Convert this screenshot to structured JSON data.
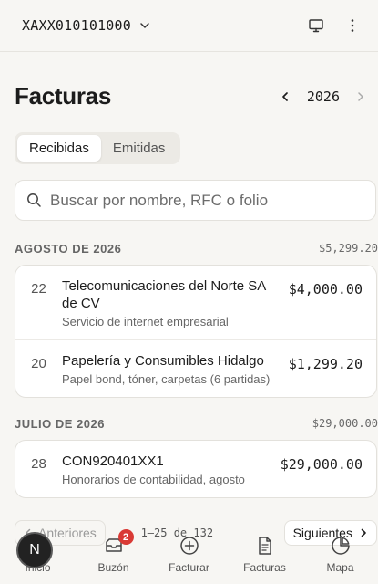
{
  "topbar": {
    "rfc": "XAXX010101000"
  },
  "header": {
    "title": "Facturas",
    "year": "2026"
  },
  "tabs": [
    {
      "label": "Recibidas",
      "active": true
    },
    {
      "label": "Emitidas",
      "active": false
    }
  ],
  "search": {
    "placeholder": "Buscar por nombre, RFC o folio"
  },
  "sections": [
    {
      "month": "AGOSTO DE 2026",
      "total": "$5,299.20",
      "items": [
        {
          "day": "22",
          "name": "Telecomunicaciones del Norte SA de CV",
          "desc": "Servicio de internet empresarial",
          "amount": "$4,000.00"
        },
        {
          "day": "20",
          "name": "Papelería y Consumibles Hidalgo",
          "desc": "Papel bond, tóner, carpetas (6 partidas)",
          "amount": "$1,299.20"
        }
      ]
    },
    {
      "month": "JULIO DE 2026",
      "total": "$29,000.00",
      "items": [
        {
          "day": "28",
          "name": "CON920401XX1",
          "desc": "Honorarios de contabilidad, agosto",
          "amount": "$29,000.00"
        }
      ]
    }
  ],
  "pagination": {
    "prev_label": "Anteriores",
    "info": "1–25 de 132",
    "next_label": "Siguientes"
  },
  "bottom_nav": {
    "avatar_initial": "N",
    "items": [
      {
        "label": "Inicio",
        "icon": "home-icon"
      },
      {
        "label": "Buzón",
        "icon": "inbox-icon",
        "badge": "2"
      },
      {
        "label": "Facturar",
        "icon": "plus-circle-icon"
      },
      {
        "label": "Facturas",
        "icon": "document-icon"
      },
      {
        "label": "Mapa",
        "icon": "pie-chart-icon"
      }
    ]
  },
  "colors": {
    "background": "#f7f6f3",
    "badge": "#d93a35",
    "avatar": "#222222"
  }
}
